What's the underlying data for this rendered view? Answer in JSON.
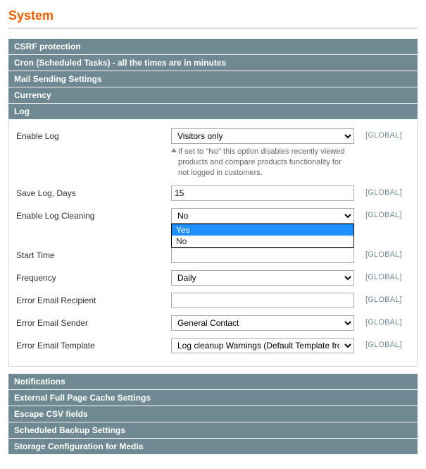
{
  "page_title": "System",
  "sections": {
    "csrf": "CSRF protection",
    "cron": "Cron (Scheduled Tasks) - all the times are in minutes",
    "mail": "Mail Sending Settings",
    "currency": "Currency",
    "log": "Log",
    "notifications": "Notifications",
    "fpc": "External Full Page Cache Settings",
    "escape_csv": "Escape CSV fields",
    "backup": "Scheduled Backup Settings",
    "storage_media": "Storage Configuration for Media"
  },
  "log": {
    "enable_log": {
      "label": "Enable Log",
      "value": "Visitors only",
      "hint": "If set to \"No\" this option disables recently viewed products and compare products functionality for not logged in customers."
    },
    "save_days": {
      "label": "Save Log, Days",
      "value": "15"
    },
    "enable_clean": {
      "label": "Enable Log Cleaning",
      "value": "No",
      "options": [
        "Yes",
        "No"
      ],
      "selected_option": "Yes"
    },
    "start_time": {
      "label": "Start Time",
      "value": ""
    },
    "frequency": {
      "label": "Frequency",
      "value": "Daily"
    },
    "err_recipient": {
      "label": "Error Email Recipient",
      "value": ""
    },
    "err_sender": {
      "label": "Error Email Sender",
      "value": "General Contact"
    },
    "err_template": {
      "label": "Error Email Template",
      "value": "Log cleanup Warnings (Default Template from"
    }
  },
  "scope_global": "[GLOBAL]"
}
